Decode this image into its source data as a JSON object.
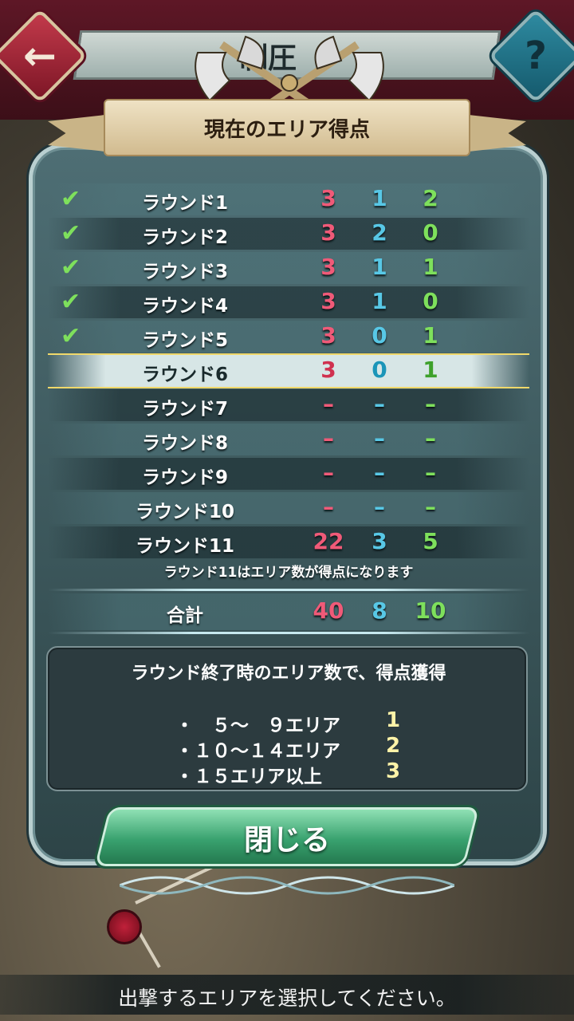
{
  "header": {
    "title": "制圧",
    "back_icon": "←",
    "help_icon": "?",
    "dialog_title": "現在のエリア得点"
  },
  "rounds": [
    {
      "label": "ラウンド1",
      "cleared": true,
      "scores": [
        "3",
        "1",
        "2"
      ]
    },
    {
      "label": "ラウンド2",
      "cleared": true,
      "scores": [
        "3",
        "2",
        "0"
      ]
    },
    {
      "label": "ラウンド3",
      "cleared": true,
      "scores": [
        "3",
        "1",
        "1"
      ]
    },
    {
      "label": "ラウンド4",
      "cleared": true,
      "scores": [
        "3",
        "1",
        "0"
      ]
    },
    {
      "label": "ラウンド5",
      "cleared": true,
      "scores": [
        "3",
        "0",
        "1"
      ]
    },
    {
      "label": "ラウンド6",
      "cleared": false,
      "current": true,
      "scores": [
        "3",
        "0",
        "1"
      ]
    },
    {
      "label": "ラウンド7",
      "cleared": false,
      "scores": [
        "–",
        "–",
        "–"
      ]
    },
    {
      "label": "ラウンド8",
      "cleared": false,
      "scores": [
        "–",
        "–",
        "–"
      ]
    },
    {
      "label": "ラウンド9",
      "cleared": false,
      "scores": [
        "–",
        "–",
        "–"
      ]
    },
    {
      "label": "ラウンド10",
      "cleared": false,
      "scores": [
        "–",
        "–",
        "–"
      ]
    },
    {
      "label": "ラウンド11",
      "cleared": false,
      "scores": [
        "22",
        "3",
        "5"
      ]
    }
  ],
  "check_icon": "✔",
  "round11_note": "ラウンド11はエリア数が得点になります",
  "total": {
    "label": "合計",
    "scores": [
      "40",
      "8",
      "10"
    ]
  },
  "info": {
    "title": "ラウンド終了時のエリア数で、得点獲得",
    "tiers": [
      {
        "range": "・　５～　９エリア",
        "points": "1"
      },
      {
        "range": "・１０～１４エリア",
        "points": "2"
      },
      {
        "range": "・１５エリア以上",
        "points": "3"
      }
    ]
  },
  "close_label": "閉じる",
  "footer_hint": "出撃するエリアを選択してください。",
  "colors": {
    "team1": "#f05a78",
    "team2": "#58c8e6",
    "team3": "#7ee05c",
    "close_button": "#39a26f",
    "banner": "#e0cca4"
  }
}
